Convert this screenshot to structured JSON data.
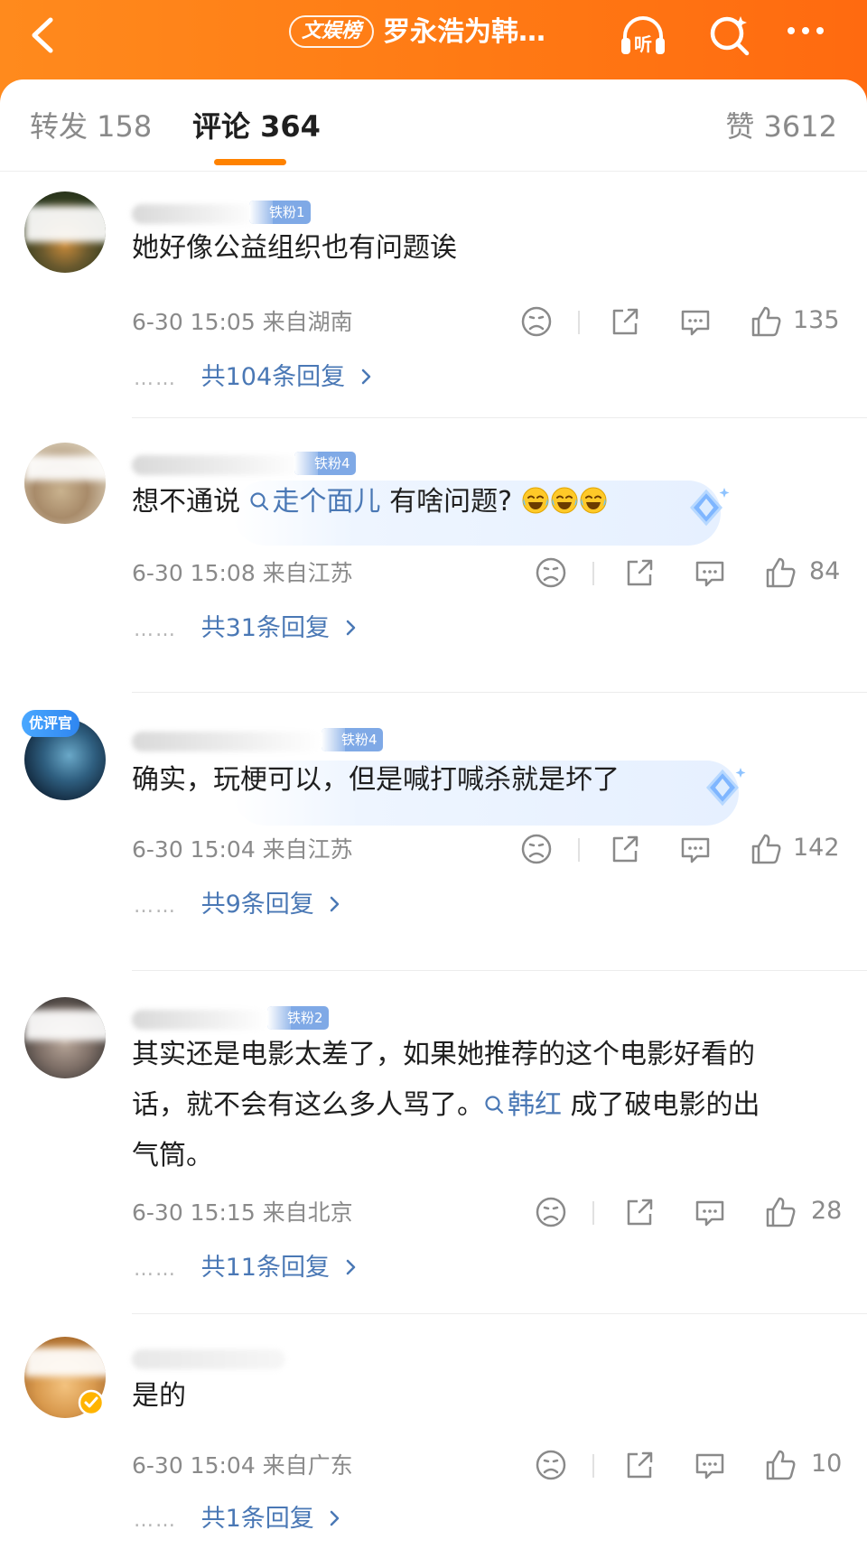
{
  "header": {
    "topic_tag": "文娱榜",
    "title": "罗永浩为韩红..."
  },
  "tabs": {
    "repost": "转发 158",
    "comment": "评论 364",
    "like": "赞 3612"
  },
  "comments": [
    {
      "fan_badge": "铁粉1",
      "text": "她好像公益组织也有问题诶",
      "meta": "6-30 15:05  来自湖南",
      "likes": "135",
      "replies": "共104条回复"
    },
    {
      "fan_badge": "铁粉4",
      "text_before": "想不通说 ",
      "link": "走个面儿",
      "text_after": " 有啥问题?",
      "emojis": [
        "laugh-cry-emoji",
        "laugh-cry-emoji",
        "laugh-cry-emoji"
      ],
      "meta": "6-30 15:08  来自江苏",
      "likes": "84",
      "replies": "共31条回复"
    },
    {
      "avatar_badge": "优评官",
      "fan_badge": "铁粉4",
      "text": "确实，玩梗可以，但是喊打喊杀就是坏了",
      "meta": "6-30 15:04  来自江苏",
      "likes": "142",
      "replies": "共9条回复"
    },
    {
      "fan_badge": "铁粉2",
      "text_line1": "其实还是电影太差了，如果她推荐的这个电影好看的",
      "text_line2_before": "话，就不会有这么多人骂了。",
      "link": "韩红",
      "text_line2_after": " 成了破电影的出",
      "text_line3": "气筒。",
      "meta": "6-30 15:15  来自北京",
      "likes": "28",
      "replies": "共11条回复"
    },
    {
      "text": "是的",
      "meta": "6-30 15:04  来自广东",
      "likes": "10",
      "replies": "共1条回复"
    }
  ],
  "dots": "……",
  "colors": {
    "header_orange": "#ff7a14",
    "tab_underline": "#ff8200",
    "link_blue": "#4a78b5",
    "meta_gray": "#8a8a8a"
  }
}
